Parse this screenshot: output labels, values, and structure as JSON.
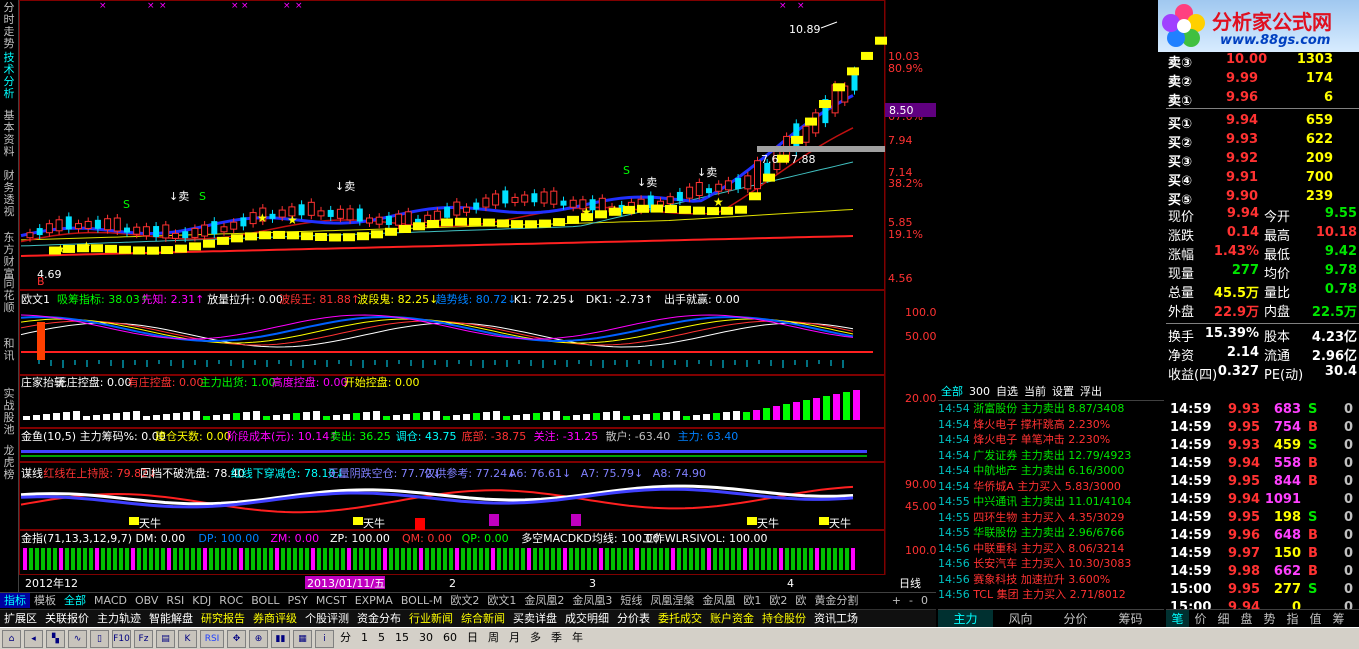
{
  "left_tabs": [
    "分时走势",
    "技术分析",
    "基本资料",
    "财务透视",
    "东方财富",
    "同花顺",
    "和讯",
    "实战股池",
    "龙虎榜"
  ],
  "chart": {
    "price_labels": [
      "10.03",
      "80.9%",
      "67.6%",
      "7.94",
      "7.14",
      "38.2%",
      "5.85",
      "19.1%",
      "4.56"
    ],
    "callout_high": "10.89",
    "callout_low": "4.69",
    "current_price_tag": "8.50",
    "box_labels": [
      "7.6",
      "7.88"
    ],
    "markers": [
      "卖",
      "卖",
      "卖",
      "卖",
      "S",
      "S",
      "S",
      "B"
    ],
    "ind1_name": "欧文1",
    "ind1_items": [
      {
        "text": "吸筹指标: 38.03↑",
        "color": "#00ff00"
      },
      {
        "text": "先知: 2.31↑",
        "color": "#ff00ff"
      },
      {
        "text": "放量拉升: 0.00",
        "color": "#ffffff"
      },
      {
        "text": "波段王: 81.88↑",
        "color": "#ff3232"
      },
      {
        "text": "波段鬼: 82.25↓",
        "color": "#ffff00"
      },
      {
        "text": "趋势线: 80.72↓",
        "color": "#0080ff"
      },
      {
        "text": "K1: 72.25↓",
        "color": "#ffffff"
      },
      {
        "text": "DK1: -2.73↑",
        "color": "#ffffff"
      },
      {
        "text": "出手就赢: 0.00",
        "color": "#ffffff"
      }
    ],
    "ind1_scale": [
      "100.0",
      "50.00"
    ],
    "ind2_items": [
      {
        "text": "庄家抬轿",
        "color": "#ffffff"
      },
      {
        "text": "无庄控盘: 0.00",
        "color": "#ffffff"
      },
      {
        "text": "有庄控盘: 0.00",
        "color": "#ff3232"
      },
      {
        "text": "主力出货: 1.00",
        "color": "#00ff00"
      },
      {
        "text": "高度控盘: 0.00",
        "color": "#ff00ff"
      },
      {
        "text": "开始控盘: 0.00",
        "color": "#ffff00"
      }
    ],
    "ind2_scale": [
      "20.00"
    ],
    "ind3_items": [
      {
        "text": "金鱼(10,5) 主力筹码%: 0.00",
        "color": "#ffffff"
      },
      {
        "text": "建仓天数: 0.00",
        "color": "#ffff00"
      },
      {
        "text": "阶段成本(元): 10.14↑",
        "color": "#ff00ff"
      },
      {
        "text": "卖出: 36.25",
        "color": "#00ff00"
      },
      {
        "text": "调仓: 43.75",
        "color": "#00ffff"
      },
      {
        "text": "底部: -38.75",
        "color": "#ff3232"
      },
      {
        "text": "关注: -31.25",
        "color": "#ff00ff"
      },
      {
        "text": "散户: -63.40",
        "color": "#c0c0c0"
      },
      {
        "text": "主力: 63.40",
        "color": "#0080ff"
      }
    ],
    "ind4_items": [
      {
        "text": "谋线",
        "color": "#ffffff"
      },
      {
        "text": "红线在上持股: 79.82↓",
        "color": "#ff3232"
      },
      {
        "text": "回档不破洗盘: 78.40",
        "color": "#ffffff"
      },
      {
        "text": "红线下穿减仓: 78.10↓",
        "color": "#00ffff"
      },
      {
        "text": "无量阴跌空仓: 77.72↓",
        "color": "#8080ff"
      },
      {
        "text": "仅供参考: 77.24↓",
        "color": "#8080ff"
      },
      {
        "text": "A6: 76.61↓",
        "color": "#8080ff"
      },
      {
        "text": "A7: 75.79↓",
        "color": "#8080ff"
      },
      {
        "text": "A8: 74.90",
        "color": "#8080ff"
      }
    ],
    "ind4_scale": [
      "90.00",
      "45.00"
    ],
    "ind4_marks": [
      "天牛",
      "天牛",
      "天牛",
      "天牛",
      "天牛"
    ],
    "ind5_items": [
      {
        "text": "金指(71,13,3,12,9,7) DM: 0.00",
        "color": "#ffffff"
      },
      {
        "text": "DP: 100.00",
        "color": "#0080ff"
      },
      {
        "text": "ZM: 0.00",
        "color": "#ff00ff"
      },
      {
        "text": "ZP: 100.00",
        "color": "#ffffff"
      },
      {
        "text": "QM: 0.00",
        "color": "#ff3232"
      },
      {
        "text": "QP: 0.00",
        "color": "#00ff00"
      },
      {
        "text": "多空MACDKD均线: 100.00",
        "color": "#ffffff"
      },
      {
        "text": "工作WLRSIVOL: 100.00",
        "color": "#ffffff"
      }
    ],
    "ind5_scale": [
      "100.0"
    ],
    "xaxis": [
      "2012年12",
      "2013/01/11/五",
      "2",
      "3",
      "4"
    ],
    "period_label": "日线"
  },
  "bottom_tabs": [
    "指标",
    "模板",
    "全部",
    "MACD",
    "OBV",
    "RSI",
    "KDJ",
    "ROC",
    "BOLL",
    "PSY",
    "MCST",
    "EXPMA",
    "BOLL-M",
    "欧文2",
    "欧文1",
    "金凤凰2",
    "金凤凰3",
    "短线",
    "凤凰涅槃",
    "金凤凰",
    "欧1",
    "欧2",
    "欧",
    "黄金分割"
  ],
  "bottom_tabs_active": "指标",
  "zoom_buttons": [
    "+",
    "-",
    "0"
  ],
  "bottom_tabs2": [
    {
      "text": "扩展区",
      "color": "#ffffff"
    },
    {
      "text": "关联报价",
      "color": "#ffffff"
    },
    {
      "text": "主力轨迹",
      "color": "#ffffff"
    },
    {
      "text": "智能解盘",
      "color": "#ffffff"
    },
    {
      "text": "研究报告",
      "color": "#ffff00"
    },
    {
      "text": "券商评级",
      "color": "#ffff00"
    },
    {
      "text": "个股评测",
      "color": "#ffffff"
    },
    {
      "text": "资金分布",
      "color": "#ffffff"
    },
    {
      "text": "行业新闻",
      "color": "#ffff00"
    },
    {
      "text": "综合新闻",
      "color": "#ffff00"
    },
    {
      "text": "买卖详盘",
      "color": "#ffffff"
    },
    {
      "text": "成交明细",
      "color": "#ffffff"
    },
    {
      "text": "分价表",
      "color": "#ffffff"
    },
    {
      "text": "委托成交",
      "color": "#ffff00"
    },
    {
      "text": "账户资金",
      "color": "#ffff00"
    },
    {
      "text": "持仓股份",
      "color": "#ffff00"
    },
    {
      "text": "资讯工场",
      "color": "#ffffff"
    }
  ],
  "toolbar": {
    "periods": [
      "分",
      "1",
      "5",
      "15",
      "30",
      "60",
      "日",
      "周",
      "月",
      "多",
      "季",
      "年"
    ]
  },
  "right": {
    "logo_text": "分析家公式网",
    "logo_url": "www.88gs.com",
    "asks": [
      {
        "label": "卖③",
        "price": "10.00",
        "vol": "1303"
      },
      {
        "label": "卖②",
        "price": "9.99",
        "vol": "174"
      },
      {
        "label": "卖①",
        "price": "9.96",
        "vol": "6"
      }
    ],
    "bids": [
      {
        "label": "买①",
        "price": "9.94",
        "vol": "659"
      },
      {
        "label": "买②",
        "price": "9.93",
        "vol": "622"
      },
      {
        "label": "买③",
        "price": "9.92",
        "vol": "209"
      },
      {
        "label": "买④",
        "price": "9.91",
        "vol": "700"
      },
      {
        "label": "买⑤",
        "price": "9.90",
        "vol": "239"
      }
    ],
    "stats": [
      {
        "l1": "现价",
        "v1": "9.94",
        "c1": "red",
        "l2": "今开",
        "v2": "9.55",
        "c2": "grn"
      },
      {
        "l1": "涨跌",
        "v1": "0.14",
        "c1": "red",
        "l2": "最高",
        "v2": "10.18",
        "c2": "red"
      },
      {
        "l1": "涨幅",
        "v1": "1.43%",
        "c1": "red",
        "l2": "最低",
        "v2": "9.42",
        "c2": "grn"
      },
      {
        "l1": "现量",
        "v1": "277",
        "c1": "grn",
        "l2": "均价",
        "v2": "9.78",
        "c2": "grn"
      },
      {
        "l1": "总量",
        "v1": "45.5万",
        "c1": "yel",
        "l2": "量比",
        "v2": "0.78",
        "c2": "grn"
      },
      {
        "l1": "外盘",
        "v1": "22.9万",
        "c1": "red",
        "l2": "内盘",
        "v2": "22.5万",
        "c2": "grn"
      },
      {
        "l1": "换手",
        "v1": "15.39%",
        "c1": "wht",
        "l2": "股本",
        "v2": "4.23亿",
        "c2": "wht"
      },
      {
        "l1": "净资",
        "v1": "2.14",
        "c1": "wht",
        "l2": "流通",
        "v2": "2.96亿",
        "c2": "wht"
      },
      {
        "l1": "收益(四)",
        "v1": "0.327",
        "c1": "wht",
        "l2": "PE(动)",
        "v2": "30.4",
        "c2": "wht"
      }
    ],
    "news_tabs": [
      "全部",
      "300",
      "自选",
      "当前",
      "设置",
      "浮出"
    ],
    "news": [
      {
        "time": "14:54",
        "name": "浙富股份",
        "act": "主力卖出",
        "val": "8.87/3408",
        "c": "grn"
      },
      {
        "time": "14:54",
        "name": "烽火电子",
        "act": "撑杆跳高",
        "val": "2.230%",
        "c": "red"
      },
      {
        "time": "14:54",
        "name": "烽火电子",
        "act": "单笔冲击",
        "val": "2.230%",
        "c": "red"
      },
      {
        "time": "14:54",
        "name": "广发证券",
        "act": "主力卖出",
        "val": "12.79/4923",
        "c": "grn"
      },
      {
        "time": "14:54",
        "name": "中航地产",
        "act": "主力卖出",
        "val": "6.16/3000",
        "c": "grn"
      },
      {
        "time": "14:54",
        "name": "华侨城A",
        "act": "主力买入",
        "val": "5.83/3000",
        "c": "red"
      },
      {
        "time": "14:55",
        "name": "中兴通讯",
        "act": "主力卖出",
        "val": "11.01/4104",
        "c": "grn"
      },
      {
        "time": "14:55",
        "name": "四环生物",
        "act": "主力买入",
        "val": "4.35/3029",
        "c": "red"
      },
      {
        "time": "14:55",
        "name": "华联股份",
        "act": "主力卖出",
        "val": "2.96/6766",
        "c": "grn"
      },
      {
        "time": "14:56",
        "name": "中联重科",
        "act": "主力买入",
        "val": "8.06/3214",
        "c": "red"
      },
      {
        "time": "14:56",
        "name": "长安汽车",
        "act": "主力买入",
        "val": "10.30/3083",
        "c": "red"
      },
      {
        "time": "14:56",
        "name": "赛象科技",
        "act": "加速拉升",
        "val": "3.600%",
        "c": "red"
      },
      {
        "time": "14:56",
        "name": "TCL 集团",
        "act": "主力买入",
        "val": "2.71/8012",
        "c": "red"
      }
    ],
    "ticks": [
      {
        "t": "14:59",
        "p": "9.93",
        "pc": "red",
        "v": "683",
        "vc": "mag",
        "s": "S",
        "sc": "grn",
        "n": "0"
      },
      {
        "t": "14:59",
        "p": "9.95",
        "pc": "red",
        "v": "754",
        "vc": "mag",
        "s": "B",
        "sc": "red",
        "n": "0"
      },
      {
        "t": "14:59",
        "p": "9.93",
        "pc": "red",
        "v": "459",
        "vc": "yel",
        "s": "S",
        "sc": "grn",
        "n": "0"
      },
      {
        "t": "14:59",
        "p": "9.94",
        "pc": "red",
        "v": "558",
        "vc": "mag",
        "s": "B",
        "sc": "red",
        "n": "0"
      },
      {
        "t": "14:59",
        "p": "9.95",
        "pc": "red",
        "v": "844",
        "vc": "mag",
        "s": "B",
        "sc": "red",
        "n": "0"
      },
      {
        "t": "14:59",
        "p": "9.94",
        "pc": "red",
        "v": "1091",
        "vc": "mag",
        "s": "",
        "sc": "red",
        "n": "0"
      },
      {
        "t": "14:59",
        "p": "9.95",
        "pc": "red",
        "v": "198",
        "vc": "yel",
        "s": "S",
        "sc": "grn",
        "n": "0"
      },
      {
        "t": "14:59",
        "p": "9.96",
        "pc": "red",
        "v": "648",
        "vc": "mag",
        "s": "B",
        "sc": "red",
        "n": "0"
      },
      {
        "t": "14:59",
        "p": "9.97",
        "pc": "red",
        "v": "150",
        "vc": "yel",
        "s": "B",
        "sc": "red",
        "n": "0"
      },
      {
        "t": "14:59",
        "p": "9.98",
        "pc": "red",
        "v": "662",
        "vc": "mag",
        "s": "B",
        "sc": "red",
        "n": "0"
      },
      {
        "t": "15:00",
        "p": "9.95",
        "pc": "red",
        "v": "277",
        "vc": "yel",
        "s": "S",
        "sc": "grn",
        "n": "0"
      },
      {
        "t": "15:00",
        "p": "9.94",
        "pc": "red",
        "v": "0",
        "vc": "yel",
        "s": "",
        "sc": "red",
        "n": "0"
      }
    ],
    "tabs_a": [
      "主力",
      "风向",
      "分价",
      "筹码"
    ],
    "tabs_b": [
      "笔",
      "价",
      "细",
      "盘",
      "势",
      "指",
      "值",
      "筹"
    ]
  }
}
